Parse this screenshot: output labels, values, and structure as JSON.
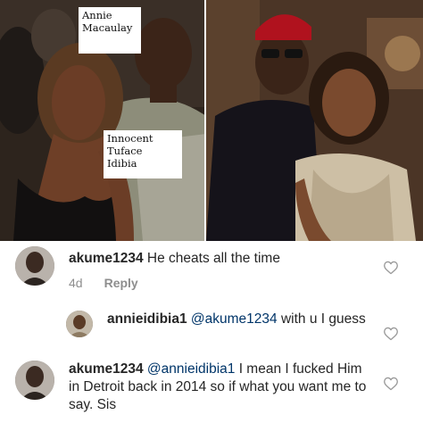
{
  "photo_labels": {
    "annie_line1": "Annie",
    "annie_line2": "Macaulay",
    "innocent_line1": "Innocent",
    "innocent_line2": "Tuface",
    "innocent_line3": "Idibia"
  },
  "comments": [
    {
      "username": "akume1234",
      "text": " He cheats all the time",
      "time": "4d",
      "reply_label": "Reply"
    },
    {
      "username": "annieidibia1",
      "mention": "@akume1234",
      "text": " with u I guess"
    },
    {
      "username": "akume1234",
      "mention": "@annieidibia1",
      "text": " I mean I fucked Him in Detroit back in 2014 so if what you want me to say. Sis"
    }
  ],
  "icons": {
    "like": "heart-outline-icon",
    "avatar": "profile-picture"
  },
  "colors": {
    "username": "#262626",
    "mention": "#003569",
    "meta": "#8e8e8e",
    "heart": "#999999"
  }
}
